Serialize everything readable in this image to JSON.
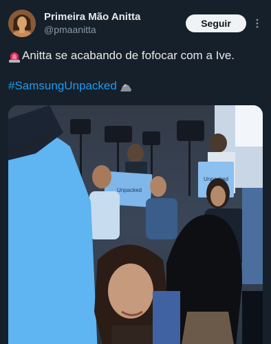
{
  "author": {
    "display_name": "Primeira Mão Anitta",
    "handle": "@pmaanitta"
  },
  "actions": {
    "follow_label": "Seguir"
  },
  "tweet": {
    "text": "Anitta se acabando de fofocar com a Ive.",
    "hashtag": "#SamsungUnpacked",
    "emoji_prefix": "siren-emoji",
    "emoji_suffix": "rock-emoji"
  },
  "media": {
    "signs": [
      "Unpacked",
      "Unpacked"
    ]
  },
  "colors": {
    "background": "#15202b",
    "primary_text": "#e7e9ea",
    "secondary_text": "#8b98a5",
    "link": "#1d9bf0",
    "button_bg": "#eff3f4"
  }
}
